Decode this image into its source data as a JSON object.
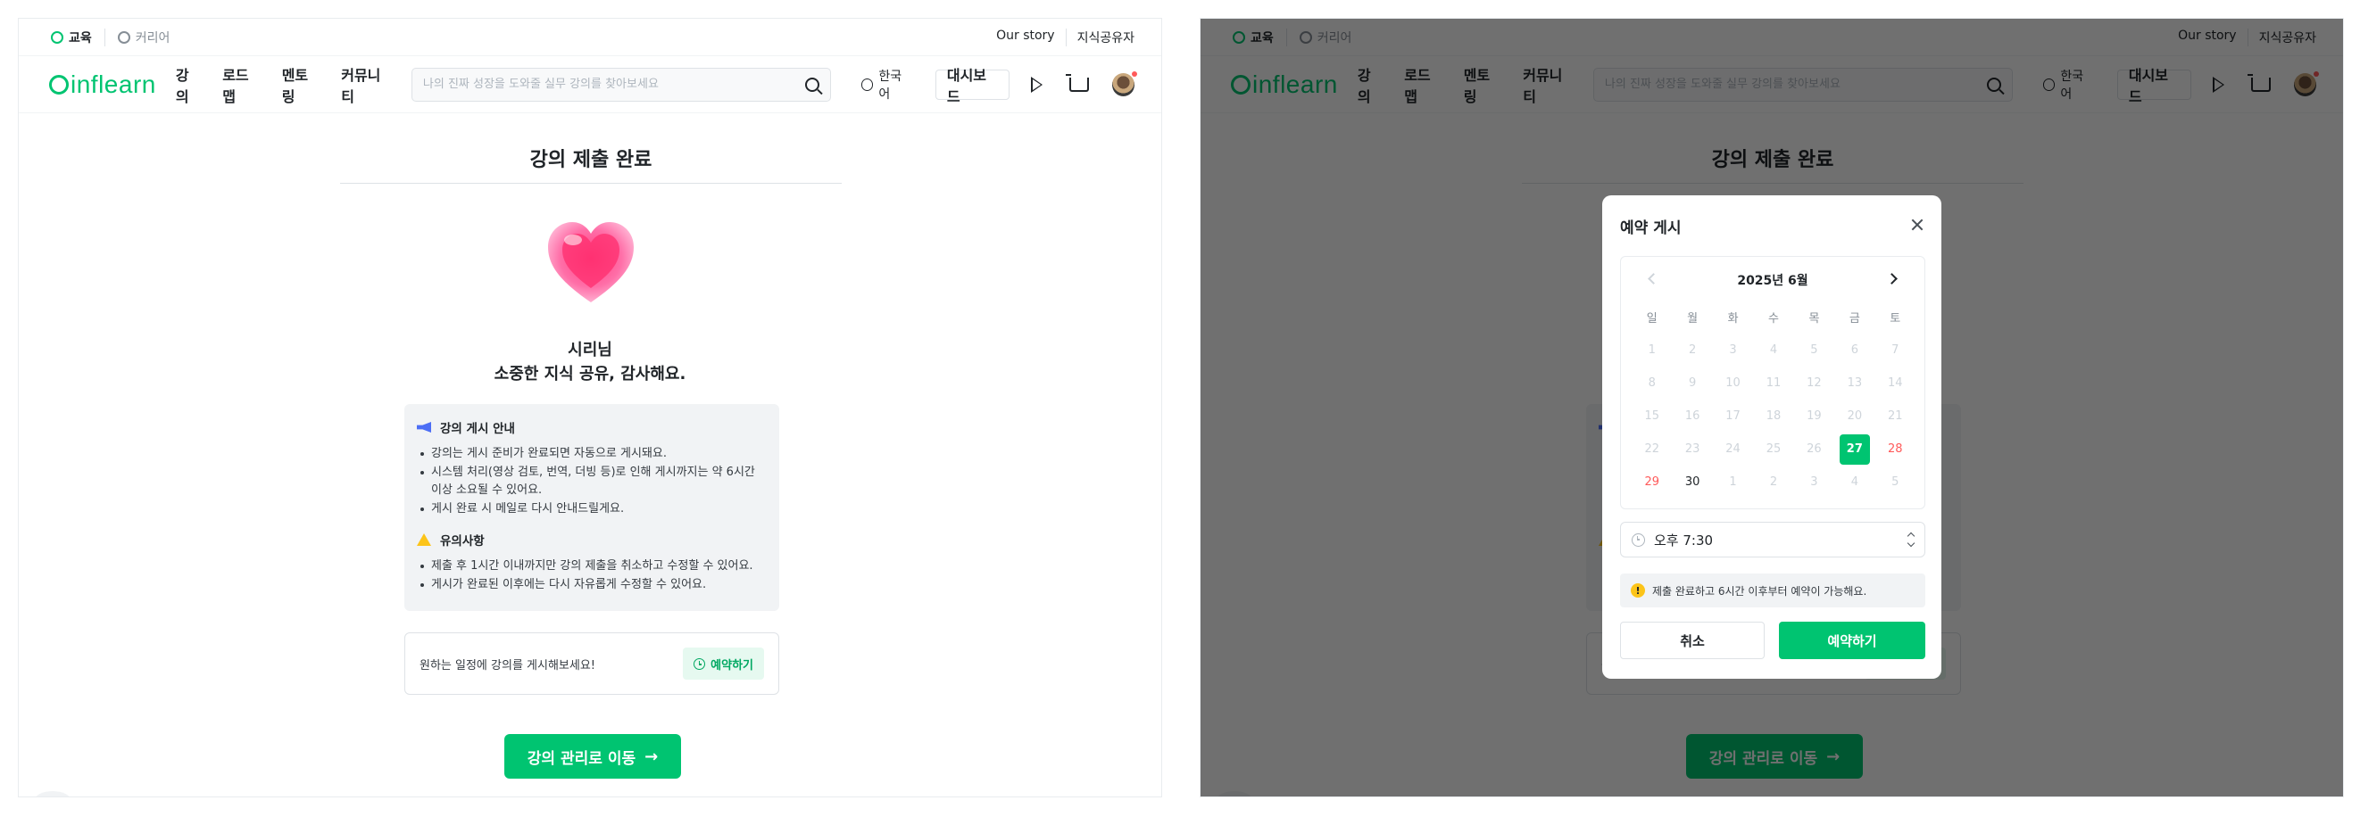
{
  "topbar": {
    "category_edu": "교육",
    "category_career": "커리어",
    "our_story": "Our story",
    "knowledge_sharer": "지식공유자"
  },
  "nav": {
    "logo": "inflearn",
    "links": [
      "강의",
      "로드맵",
      "멘토링",
      "커뮤니티"
    ],
    "search_placeholder": "나의 진짜 성장을 도와줄 실무 강의를 찾아보세요",
    "language": "한국어",
    "dashboard": "대시보드"
  },
  "content": {
    "title": "강의 제출 완료",
    "thanks_line1": "시리님",
    "thanks_line2": "소중한 지식 공유, 감사해요.",
    "notice_heading": "강의 게시 안내",
    "notice_items": [
      "강의는 게시 준비가 완료되면 자동으로 게시돼요.",
      "시스템 처리(영상 검토, 번역, 더빙 등)로 인해 게시까지는 약 6시간 이상 소요될 수 있어요.",
      "게시 완료 시 메일로 다시 안내드릴게요."
    ],
    "caution_heading": "유의사항",
    "caution_items": [
      "제출 후 1시간 이내까지만 강의 제출을 취소하고 수정할 수 있어요.",
      "게시가 완료된 이후에는 다시 자유롭게 수정할 수 있어요."
    ],
    "schedule_text": "원하는 일정에 강의를 게시해보세요!",
    "schedule_button": "예약하기",
    "manage_button": "강의 관리로 이동",
    "manage_arrow": "→"
  },
  "modal": {
    "title": "예약 게시",
    "month_label": "2025년 6월",
    "weekdays": [
      "일",
      "월",
      "화",
      "수",
      "목",
      "금",
      "토"
    ],
    "days": [
      {
        "d": "1",
        "state": "disabled"
      },
      {
        "d": "2",
        "state": "disabled"
      },
      {
        "d": "3",
        "state": "disabled"
      },
      {
        "d": "4",
        "state": "disabled"
      },
      {
        "d": "5",
        "state": "disabled"
      },
      {
        "d": "6",
        "state": "disabled"
      },
      {
        "d": "7",
        "state": "disabled"
      },
      {
        "d": "8",
        "state": "disabled"
      },
      {
        "d": "9",
        "state": "disabled"
      },
      {
        "d": "10",
        "state": "disabled"
      },
      {
        "d": "11",
        "state": "disabled"
      },
      {
        "d": "12",
        "state": "disabled"
      },
      {
        "d": "13",
        "state": "disabled"
      },
      {
        "d": "14",
        "state": "disabled"
      },
      {
        "d": "15",
        "state": "disabled"
      },
      {
        "d": "16",
        "state": "disabled"
      },
      {
        "d": "17",
        "state": "disabled"
      },
      {
        "d": "18",
        "state": "disabled"
      },
      {
        "d": "19",
        "state": "disabled"
      },
      {
        "d": "20",
        "state": "disabled"
      },
      {
        "d": "21",
        "state": "disabled"
      },
      {
        "d": "22",
        "state": "disabled"
      },
      {
        "d": "23",
        "state": "disabled"
      },
      {
        "d": "24",
        "state": "disabled"
      },
      {
        "d": "25",
        "state": "disabled"
      },
      {
        "d": "26",
        "state": "disabled"
      },
      {
        "d": "27",
        "state": "selected"
      },
      {
        "d": "28",
        "state": "weekend"
      },
      {
        "d": "29",
        "state": "weekend"
      },
      {
        "d": "30",
        "state": "active"
      },
      {
        "d": "1",
        "state": "disabled"
      },
      {
        "d": "2",
        "state": "disabled"
      },
      {
        "d": "3",
        "state": "disabled"
      },
      {
        "d": "4",
        "state": "disabled"
      },
      {
        "d": "5",
        "state": "disabled"
      }
    ],
    "time_value": "오후 7:30",
    "notice_text": "제출 완료하고 6시간 이후부터 예약이 가능해요.",
    "cancel_label": "취소",
    "reserve_label": "예약하기"
  },
  "colors": {
    "brand_green": "#00c471",
    "selected_day": "#00c471",
    "weekend_red": "#ff5a5a",
    "overlay": "rgba(0,0,0,0.56)"
  }
}
